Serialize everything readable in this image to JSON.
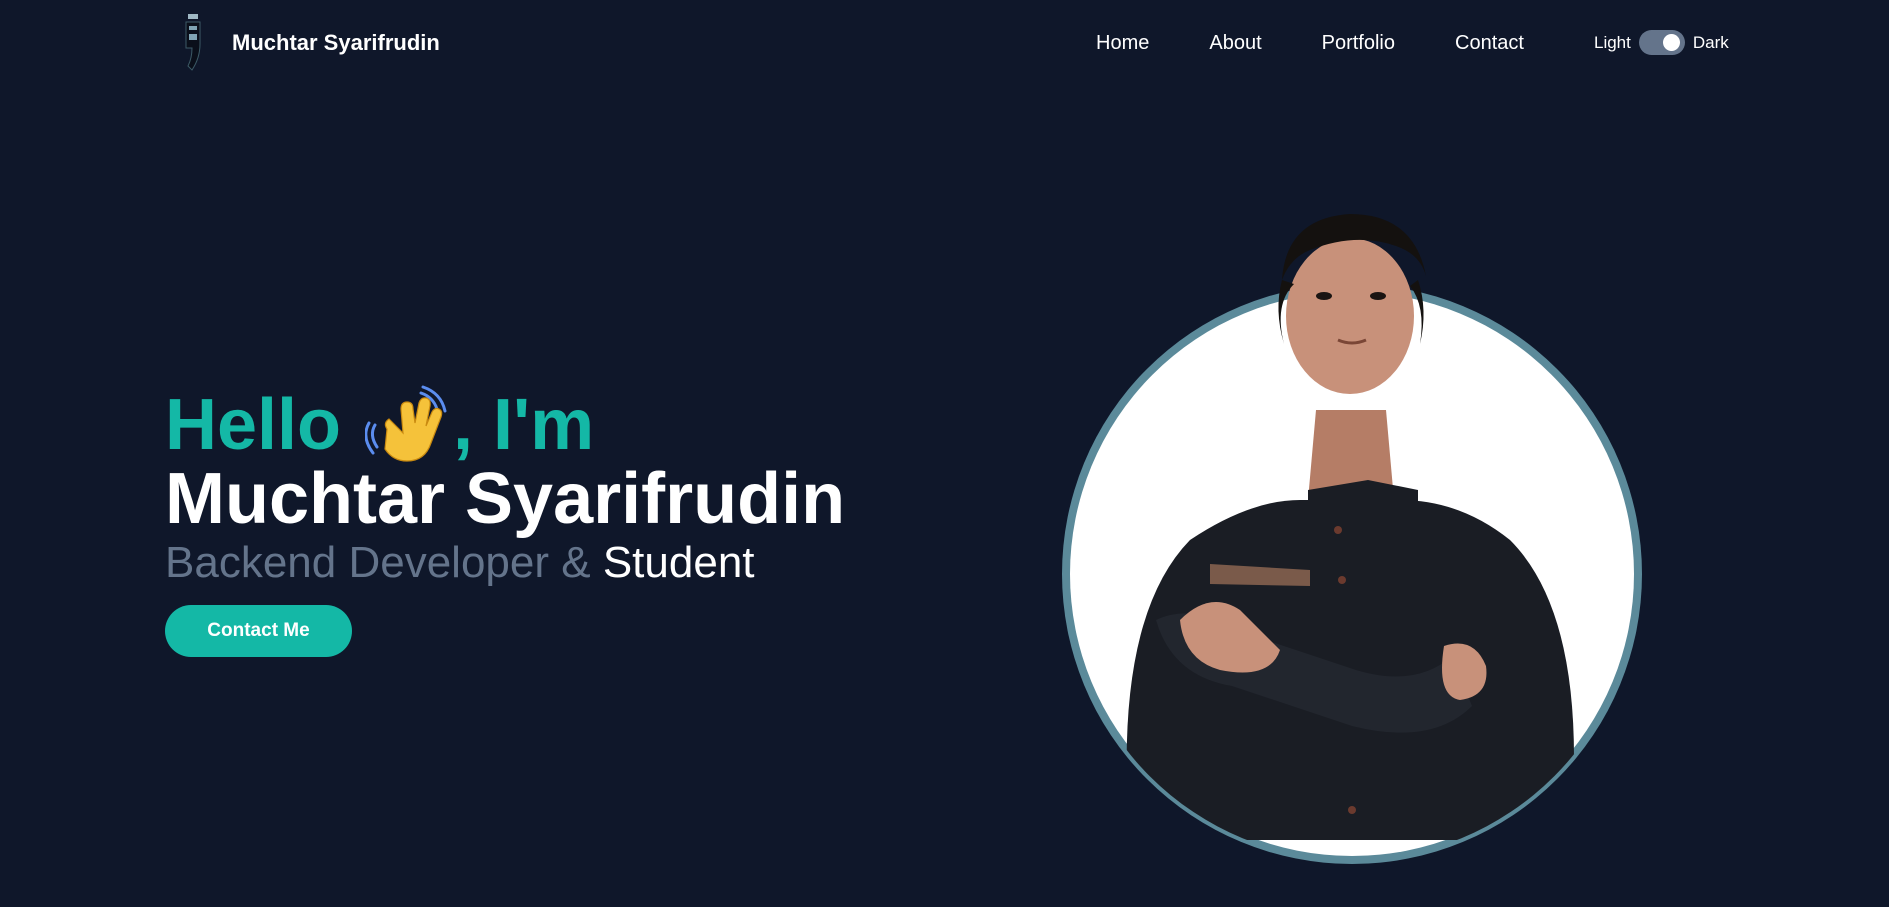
{
  "header": {
    "brand_name": "Muchtar Syarifrudin",
    "logo": "brand-logo-icon"
  },
  "nav": {
    "items": [
      {
        "label": "Home"
      },
      {
        "label": "About"
      },
      {
        "label": "Portfolio"
      },
      {
        "label": "Contact"
      }
    ]
  },
  "theme_toggle": {
    "light_label": "Light",
    "dark_label": "Dark",
    "state": "dark"
  },
  "hero": {
    "greeting_before": "Hello",
    "greeting_after": ", I'm",
    "wave_icon": "waving-hand-icon",
    "name": "Muchtar Syarifrudin",
    "role_primary": "Backend Developer &",
    "role_secondary": "Student",
    "cta_label": "Contact Me"
  },
  "colors": {
    "background": "#0f172a",
    "accent": "#14b8a6",
    "muted": "#64748b",
    "ring": "#5b8a9a"
  }
}
